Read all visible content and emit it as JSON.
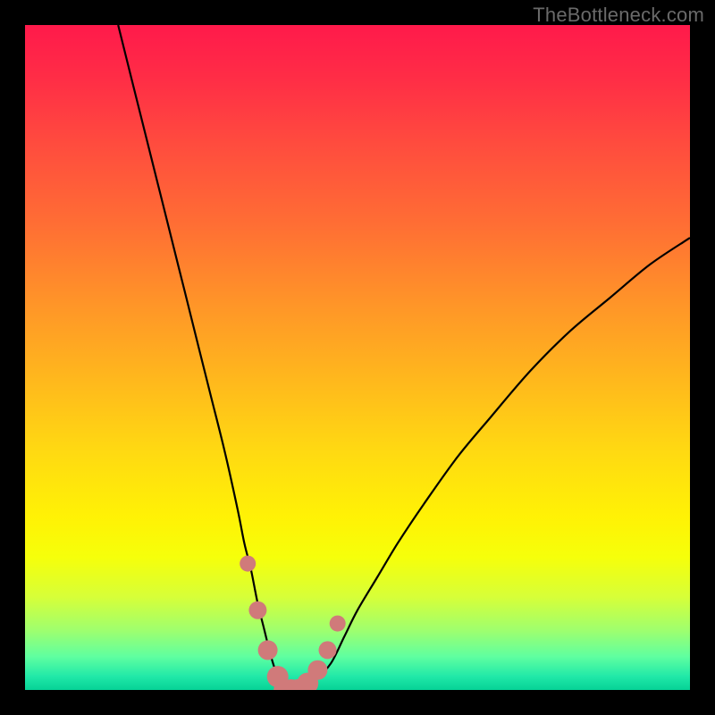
{
  "watermark": "TheBottleneck.com",
  "colors": {
    "frame": "#000000",
    "curve_stroke": "#000000",
    "marker_fill": "#d07a7a",
    "marker_stroke": "#c96c6c",
    "gradient_top": "#ff1a4b",
    "gradient_bottom": "#06d296"
  },
  "chart_data": {
    "type": "line",
    "title": "",
    "xlabel": "",
    "ylabel": "",
    "xlim": [
      0,
      100
    ],
    "ylim": [
      0,
      100
    ],
    "grid": false,
    "series": [
      {
        "name": "bottleneck-curve",
        "x": [
          14,
          16,
          18,
          20,
          22,
          24,
          26,
          28,
          30,
          32,
          33,
          34,
          35,
          36,
          37,
          38,
          39,
          40,
          41,
          42,
          44,
          46,
          48,
          50,
          53,
          56,
          60,
          65,
          70,
          76,
          82,
          88,
          94,
          100
        ],
        "y": [
          100,
          92,
          84,
          76,
          68,
          60,
          52,
          44,
          36,
          27,
          22,
          18,
          13,
          9,
          5,
          2,
          0,
          0,
          0,
          1,
          2,
          4,
          8,
          12,
          17,
          22,
          28,
          35,
          41,
          48,
          54,
          59,
          64,
          68
        ]
      }
    ],
    "markers": {
      "name": "valley-markers",
      "x": [
        33.5,
        35.0,
        36.5,
        38.0,
        39.0,
        40.0,
        41.0,
        42.5,
        44.0,
        45.5,
        47.0
      ],
      "y": [
        19,
        12,
        6,
        2,
        0,
        0,
        0,
        1,
        3,
        6,
        10
      ],
      "r": [
        9,
        10,
        11,
        12,
        12,
        12,
        12,
        12,
        11,
        10,
        9
      ]
    },
    "gradient_stops": [
      {
        "pos": 0.0,
        "color": "#ff1a4b"
      },
      {
        "pos": 0.08,
        "color": "#ff2d46"
      },
      {
        "pos": 0.18,
        "color": "#ff4c3e"
      },
      {
        "pos": 0.3,
        "color": "#ff6e34"
      },
      {
        "pos": 0.42,
        "color": "#ff9528"
      },
      {
        "pos": 0.54,
        "color": "#ffba1c"
      },
      {
        "pos": 0.64,
        "color": "#ffd912"
      },
      {
        "pos": 0.74,
        "color": "#fff205"
      },
      {
        "pos": 0.8,
        "color": "#f6ff0a"
      },
      {
        "pos": 0.86,
        "color": "#d7ff38"
      },
      {
        "pos": 0.91,
        "color": "#9fff6e"
      },
      {
        "pos": 0.95,
        "color": "#5fffa0"
      },
      {
        "pos": 0.98,
        "color": "#20e8a8"
      },
      {
        "pos": 1.0,
        "color": "#06d296"
      }
    ]
  }
}
